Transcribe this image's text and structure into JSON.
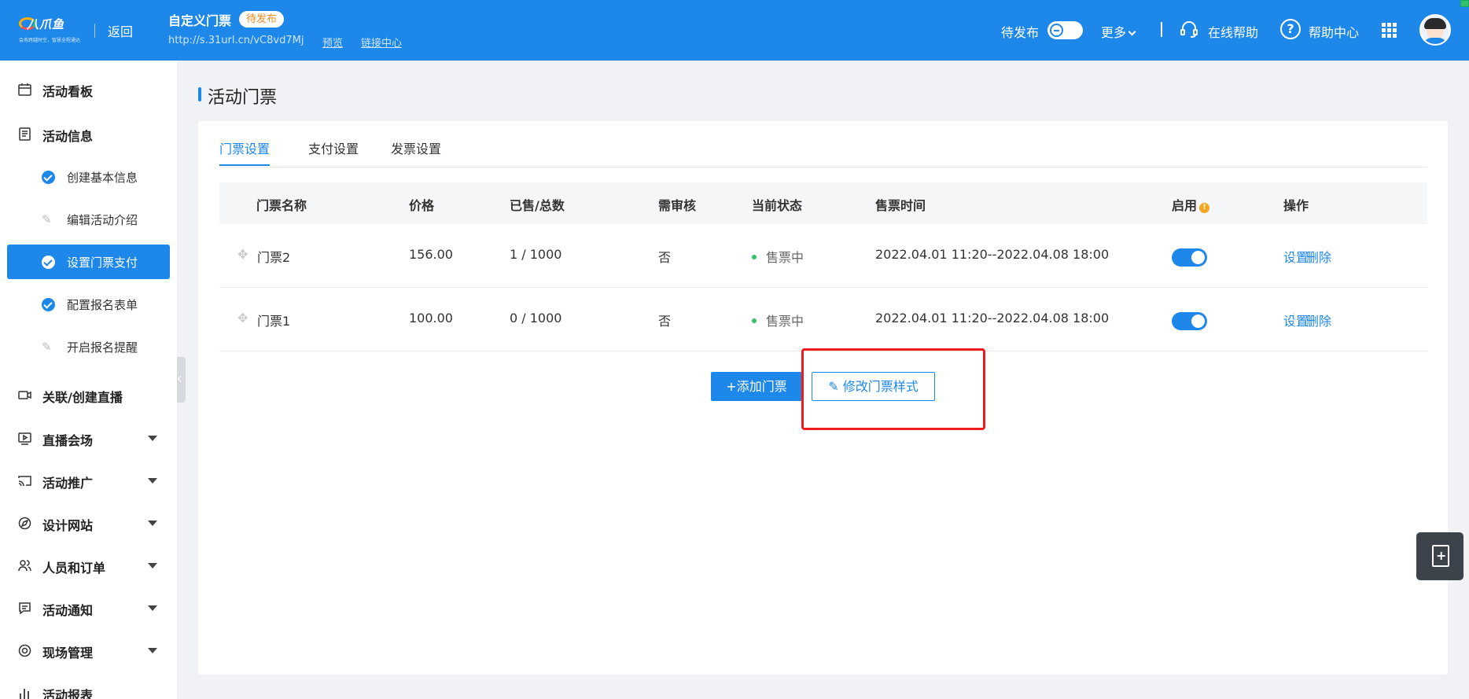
{
  "header": {
    "logo_text": "八爪鱼",
    "logo_slogan": "会务跨越时空，智慧全程通达",
    "back_label": "返回",
    "event_title": "自定义门票",
    "status_badge": "待发布",
    "event_url": "http://s.31url.cn/vC8vd7Mj",
    "preview_label": "预览",
    "link_center_label": "链接中心",
    "publish_state_label": "待发布",
    "more_label": "更多",
    "online_help_label": "在线帮助",
    "help_center_label": "帮助中心"
  },
  "sidebar": {
    "items": [
      {
        "label": "活动看板",
        "icon": "calendar-icon"
      },
      {
        "label": "活动信息",
        "icon": "document-icon"
      },
      {
        "label": "关联/创建直播",
        "icon": "video-icon"
      },
      {
        "label": "直播会场",
        "icon": "live-venue-icon"
      },
      {
        "label": "活动推广",
        "icon": "cast-icon"
      },
      {
        "label": "设计网站",
        "icon": "compass-icon"
      },
      {
        "label": "人员和订单",
        "icon": "people-icon"
      },
      {
        "label": "活动通知",
        "icon": "notice-icon"
      },
      {
        "label": "现场管理",
        "icon": "target-icon"
      },
      {
        "label": "活动报表",
        "icon": "bar-chart-icon"
      }
    ],
    "sub_items": [
      {
        "label": "创建基本信息",
        "state": "done"
      },
      {
        "label": "编辑活动介绍",
        "state": "pending"
      },
      {
        "label": "设置门票支付",
        "state": "active"
      },
      {
        "label": "配置报名表单",
        "state": "done"
      },
      {
        "label": "开启报名提醒",
        "state": "pending"
      }
    ]
  },
  "main": {
    "page_title": "活动门票",
    "tabs": [
      "门票设置",
      "支付设置",
      "发票设置"
    ],
    "active_tab": "门票设置",
    "table": {
      "columns": [
        "门票名称",
        "价格",
        "已售/总数",
        "需审核",
        "当前状态",
        "售票时间",
        "启用",
        "操作"
      ],
      "rows": [
        {
          "name": "门票2",
          "price": "156.00",
          "sold": "1 / 1000",
          "review": "否",
          "status": "售票中",
          "time": "2022.04.01 11:20--2022.04.08 18:00",
          "enabled": true,
          "op_set": "设置",
          "op_delete": "删除"
        },
        {
          "name": "门票1",
          "price": "100.00",
          "sold": "0 / 1000",
          "review": "否",
          "status": "售票中",
          "time": "2022.04.01 11:20--2022.04.08 18:00",
          "enabled": true,
          "op_set": "设置",
          "op_delete": "删除"
        }
      ]
    },
    "add_ticket_label": "+添加门票",
    "modify_style_label": "修改门票样式"
  },
  "colors": {
    "primary": "#1d87ea",
    "badge_text": "#f08a1b",
    "status_green": "#35c16a",
    "highlight_red": "#ee1c1c",
    "info_orange": "#f5a623"
  }
}
